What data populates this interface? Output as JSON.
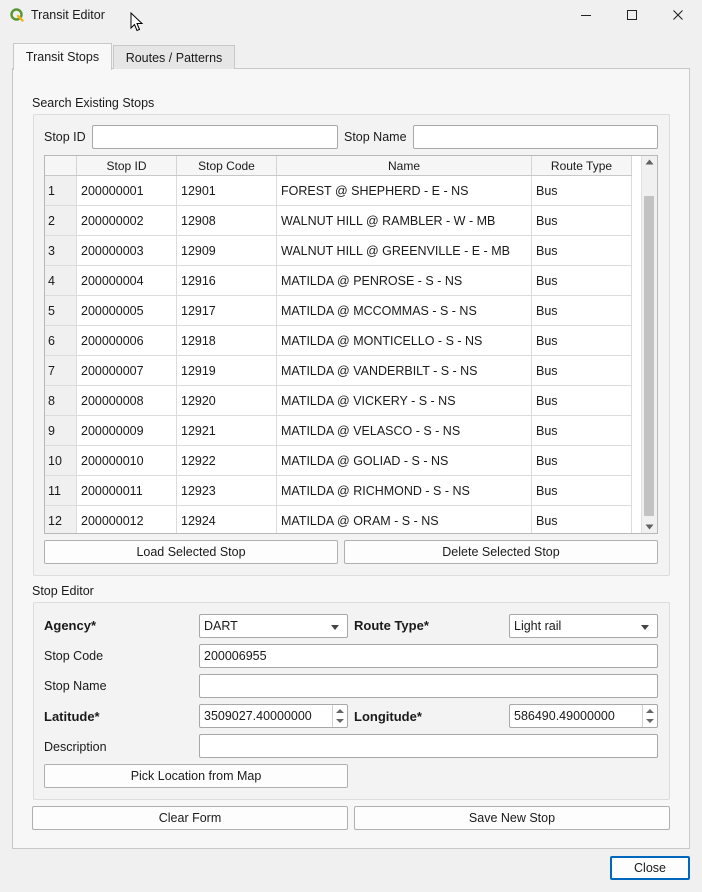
{
  "window": {
    "title": "Transit Editor"
  },
  "tabs": [
    {
      "label": "Transit Stops",
      "active": true
    },
    {
      "label": "Routes / Patterns",
      "active": false
    }
  ],
  "search": {
    "section_title": "Search Existing Stops",
    "stop_id_label": "Stop ID",
    "stop_id_value": "",
    "stop_name_label": "Stop Name",
    "stop_name_value": ""
  },
  "table": {
    "columns": [
      "Stop ID",
      "Stop Code",
      "Name",
      "Route Type"
    ],
    "rows": [
      {
        "num": "1",
        "stop_id": "200000001",
        "stop_code": "12901",
        "name": "FOREST @ SHEPHERD - E - NS",
        "route_type": "Bus"
      },
      {
        "num": "2",
        "stop_id": "200000002",
        "stop_code": "12908",
        "name": "WALNUT HILL @ RAMBLER - W - MB",
        "route_type": "Bus"
      },
      {
        "num": "3",
        "stop_id": "200000003",
        "stop_code": "12909",
        "name": "WALNUT HILL @ GREENVILLE - E - MB",
        "route_type": "Bus"
      },
      {
        "num": "4",
        "stop_id": "200000004",
        "stop_code": "12916",
        "name": "MATILDA @ PENROSE - S - NS",
        "route_type": "Bus"
      },
      {
        "num": "5",
        "stop_id": "200000005",
        "stop_code": "12917",
        "name": "MATILDA @ MCCOMMAS - S - NS",
        "route_type": "Bus"
      },
      {
        "num": "6",
        "stop_id": "200000006",
        "stop_code": "12918",
        "name": "MATILDA @ MONTICELLO - S - NS",
        "route_type": "Bus"
      },
      {
        "num": "7",
        "stop_id": "200000007",
        "stop_code": "12919",
        "name": "MATILDA @ VANDERBILT - S - NS",
        "route_type": "Bus"
      },
      {
        "num": "8",
        "stop_id": "200000008",
        "stop_code": "12920",
        "name": "MATILDA @ VICKERY - S - NS",
        "route_type": "Bus"
      },
      {
        "num": "9",
        "stop_id": "200000009",
        "stop_code": "12921",
        "name": "MATILDA @ VELASCO - S - NS",
        "route_type": "Bus"
      },
      {
        "num": "10",
        "stop_id": "200000010",
        "stop_code": "12922",
        "name": "MATILDA @ GOLIAD - S - NS",
        "route_type": "Bus"
      },
      {
        "num": "11",
        "stop_id": "200000011",
        "stop_code": "12923",
        "name": "MATILDA @ RICHMOND - S - NS",
        "route_type": "Bus"
      },
      {
        "num": "12",
        "stop_id": "200000012",
        "stop_code": "12924",
        "name": "MATILDA @ ORAM - S - NS",
        "route_type": "Bus"
      }
    ]
  },
  "actions": {
    "load_selected": "Load Selected Stop",
    "delete_selected": "Delete Selected Stop"
  },
  "editor": {
    "section_title": "Stop Editor",
    "agency_label": "Agency*",
    "agency_value": "DART",
    "route_type_label": "Route Type*",
    "route_type_value": "Light rail",
    "stop_code_label": "Stop Code",
    "stop_code_value": "200006955",
    "stop_name_label": "Stop Name",
    "stop_name_value": "",
    "latitude_label": "Latitude*",
    "latitude_value": "3509027.40000000",
    "longitude_label": "Longitude*",
    "longitude_value": "586490.49000000",
    "description_label": "Description",
    "description_value": "",
    "pick_location": "Pick Location from Map"
  },
  "footer": {
    "clear_form": "Clear Form",
    "save_new_stop": "Save New Stop",
    "close": "Close"
  },
  "colors": {
    "qgis_green": "#589632",
    "close_focus_border": "#0067c0"
  }
}
